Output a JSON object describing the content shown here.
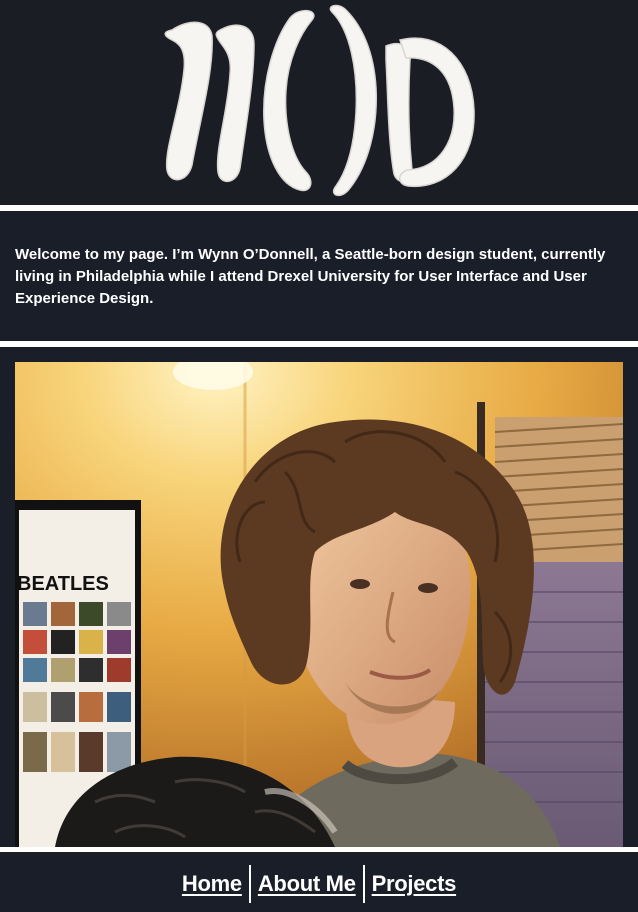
{
  "header": {
    "logo_text": "WOD"
  },
  "intro": {
    "text": "Welcome to my page. I’m Wynn O’Donnell, a Seattle-born design student, currently living in Philadelphia while I attend Drexel University for User Interface and User Experience Design."
  },
  "photo": {
    "alt": "Wynn O’Donnell holding a cat"
  },
  "poster": {
    "text": "BEATLES"
  },
  "nav": {
    "items": [
      {
        "label": "Home"
      },
      {
        "label": "About Me"
      },
      {
        "label": "Projects"
      }
    ]
  },
  "colors": {
    "header_bg": "#1a1d23",
    "section_bg": "#1a1e29",
    "divider": "#ffffff",
    "text": "#ffffff"
  }
}
